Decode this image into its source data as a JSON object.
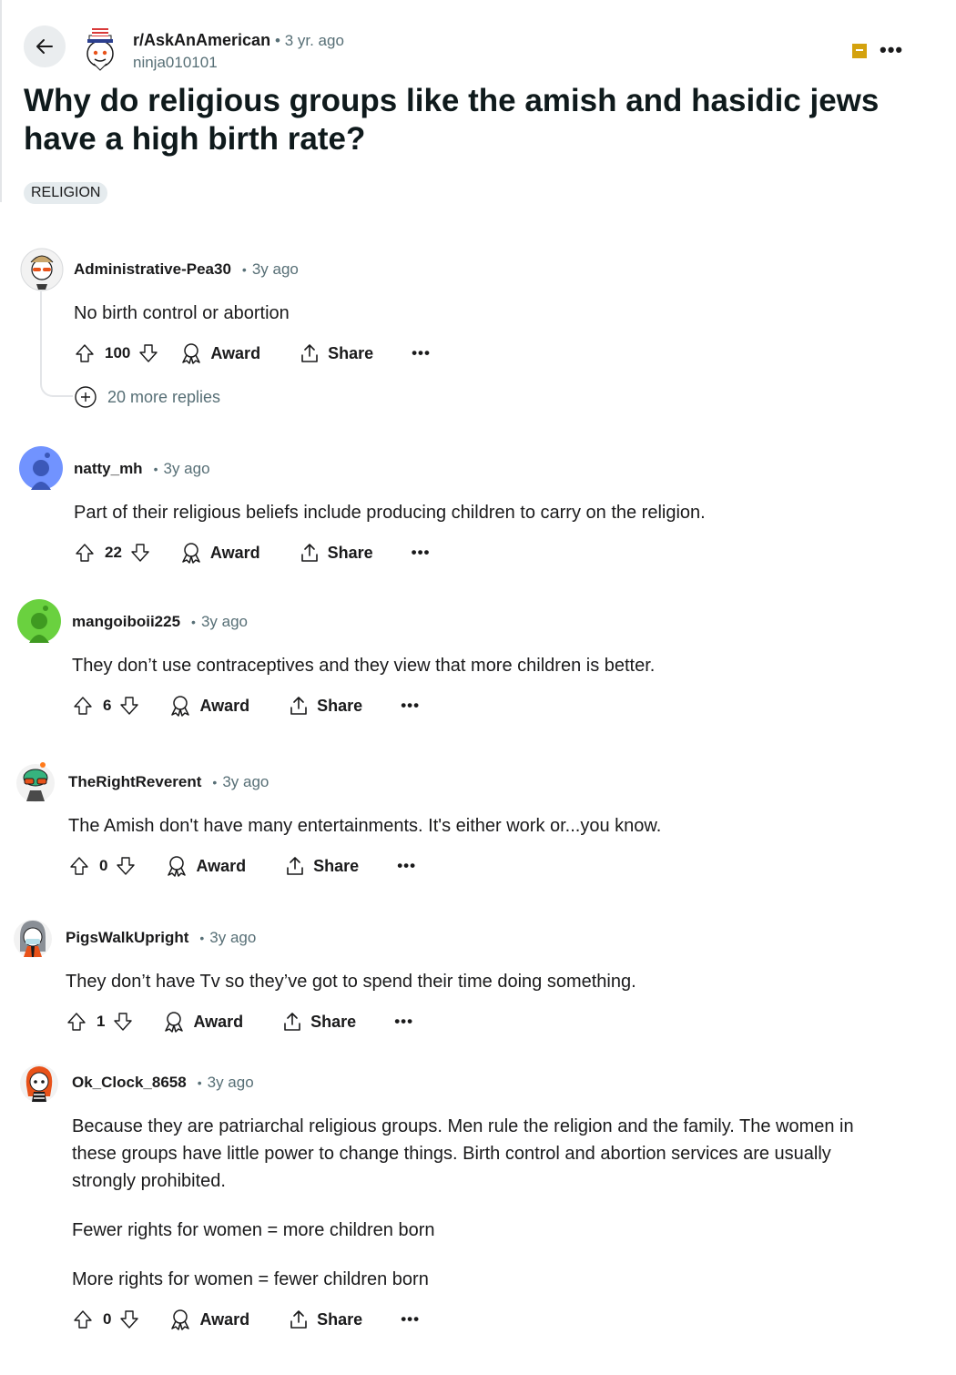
{
  "header": {
    "subreddit": "r/AskAnAmerican",
    "time_separator": "•",
    "post_age": "3 yr. ago",
    "author": "ninja010101",
    "more_label": "•••"
  },
  "post": {
    "title": "Why do religious groups like the amish and hasidic jews have a high birth rate?",
    "flair": "RELIGION"
  },
  "comments": [
    {
      "author": "Administrative-Pea30",
      "dot": "•",
      "age": "3y ago",
      "body": [
        "No birth control or abortion"
      ],
      "score": "100",
      "award_label": "Award",
      "share_label": "Share",
      "more_label": "•••",
      "more_replies": "20 more replies"
    },
    {
      "author": "natty_mh",
      "dot": "•",
      "age": "3y ago",
      "body": [
        "Part of their religious beliefs include producing children to carry on the religion."
      ],
      "score": "22",
      "award_label": "Award",
      "share_label": "Share",
      "more_label": "•••"
    },
    {
      "author": "mangoiboii225",
      "dot": "•",
      "age": "3y ago",
      "body": [
        "They don’t use contraceptives and they view that more children is better."
      ],
      "score": "6",
      "award_label": "Award",
      "share_label": "Share",
      "more_label": "•••"
    },
    {
      "author": "TheRightReverent",
      "dot": "•",
      "age": "3y ago",
      "body": [
        "The Amish don't have many entertainments. It's either work or...you know."
      ],
      "score": "0",
      "award_label": "Award",
      "share_label": "Share",
      "more_label": "•••"
    },
    {
      "author": "PigsWalkUpright",
      "dot": "•",
      "age": "3y ago",
      "body": [
        "They don’t have Tv so they’ve got to spend their time doing something."
      ],
      "score": "1",
      "award_label": "Award",
      "share_label": "Share",
      "more_label": "•••"
    },
    {
      "author": "Ok_Clock_8658",
      "dot": "•",
      "age": "3y ago",
      "body": [
        "Because they are patriarchal religious groups. Men rule the religion and the family. The women in these groups have little power to change things. Birth control and abortion services are usually strongly prohibited.",
        "Fewer rights for women = more children born",
        "More rights for women = fewer children born"
      ],
      "score": "0",
      "award_label": "Award",
      "share_label": "Share",
      "more_label": "•••"
    }
  ],
  "colors": {
    "meta_gray": "#576f76",
    "flair_bg": "#e5ebee",
    "join_icon": "#d4a20e"
  },
  "icons": [
    "back-arrow-icon",
    "upvote-icon",
    "downvote-icon",
    "award-icon",
    "share-icon",
    "plus-circle-icon"
  ]
}
